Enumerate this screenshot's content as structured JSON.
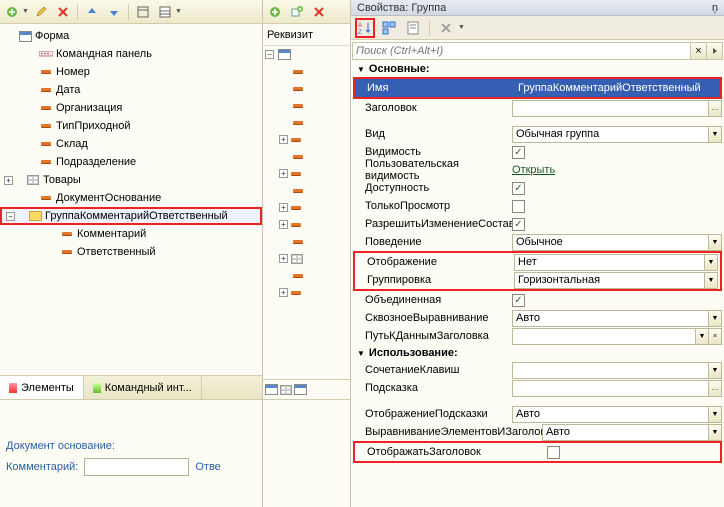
{
  "tree": {
    "root": "Форма",
    "items": [
      "Командная панель",
      "Номер",
      "Дата",
      "Организация",
      "ТипПриходной",
      "Склад",
      "Подразделение",
      "Товары",
      "ДокументОснование",
      "ГруппаКомментарийОтветственный",
      "Комментарий",
      "Ответственный"
    ]
  },
  "tabs": {
    "elements": "Элементы",
    "cmd": "Командный инт..."
  },
  "mid": {
    "header": "Реквизит"
  },
  "form_preview": {
    "doc_label": "Документ основание:",
    "comment_label": "Комментарий:",
    "resp_label": "Отве"
  },
  "props": {
    "title": "Свойства: Группа",
    "pin": "ņ",
    "search_placeholder": "Поиск (Ctrl+Alt+I)",
    "sections": {
      "main": "Основные:",
      "usage": "Использование:"
    },
    "rows": {
      "name": {
        "label": "Имя",
        "value": "ГруппаКомментарийОтветственный"
      },
      "title": {
        "label": "Заголовок",
        "value": ""
      },
      "kind": {
        "label": "Вид",
        "value": "Обычная группа"
      },
      "visibility": {
        "label": "Видимость",
        "checked": true
      },
      "user_vis": {
        "label": "Пользовательская видимость",
        "value": "Открыть"
      },
      "access": {
        "label": "Доступность",
        "checked": true
      },
      "readonly": {
        "label": "ТолькоПросмотр",
        "checked": false
      },
      "allow_change": {
        "label": "РазрешитьИзменениеСостава",
        "checked": true
      },
      "behavior": {
        "label": "Поведение",
        "value": "Обычное"
      },
      "display": {
        "label": "Отображение",
        "value": "Нет"
      },
      "grouping": {
        "label": "Группировка",
        "value": "Горизонтальная"
      },
      "united": {
        "label": "Объединенная",
        "checked": true
      },
      "through_align": {
        "label": "СквозноеВыравнивание",
        "value": "Авто"
      },
      "title_path": {
        "label": "ПутьКДаннымЗаголовка",
        "value": ""
      },
      "hotkey": {
        "label": "СочетаниеКлавиш",
        "value": ""
      },
      "hint": {
        "label": "Подсказка",
        "value": ""
      },
      "hint_display": {
        "label": "ОтображениеПодсказки",
        "value": "Авто"
      },
      "align_el": {
        "label": "ВыравниваниеЭлементовИЗаголовко",
        "value": "Авто"
      },
      "show_title": {
        "label": "ОтображатьЗаголовок",
        "checked": false
      }
    }
  }
}
